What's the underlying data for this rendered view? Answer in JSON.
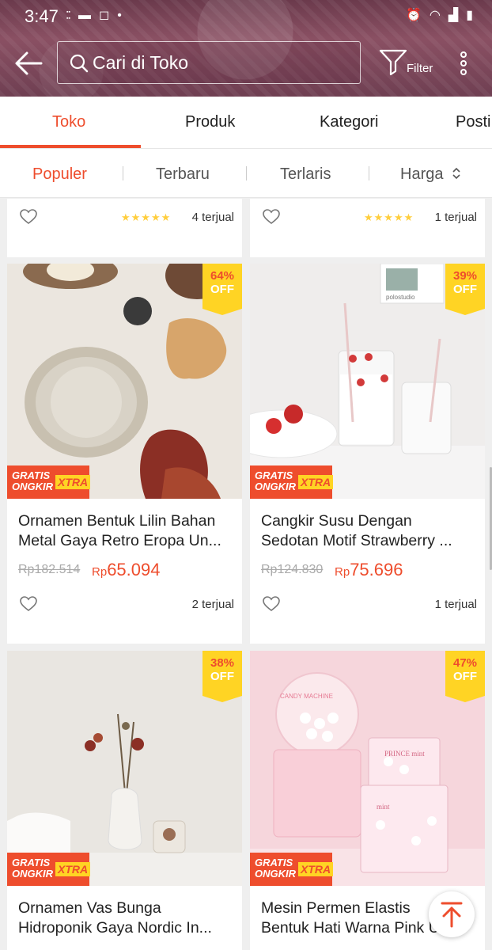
{
  "status_bar": {
    "time": "3:47"
  },
  "search": {
    "placeholder": "Cari di Toko"
  },
  "header": {
    "filter_label": "Filter"
  },
  "tabs": [
    {
      "label": "Toko",
      "active": true
    },
    {
      "label": "Produk",
      "active": false
    },
    {
      "label": "Kategori",
      "active": false
    },
    {
      "label": "Posti",
      "active": false
    }
  ],
  "sort": [
    {
      "label": "Populer",
      "active": true
    },
    {
      "label": "Terbaru",
      "active": false
    },
    {
      "label": "Terlaris",
      "active": false
    },
    {
      "label": "Harga",
      "active": false
    }
  ],
  "top_cards": [
    {
      "sold": "4 terjual",
      "rating_stars": 5
    },
    {
      "sold": "1 terjual",
      "rating_stars": 5
    }
  ],
  "products": [
    {
      "name_line1": "Ornamen Bentuk Lilin Bahan",
      "name_line2": "Metal Gaya Retro Eropa Un...",
      "old_price": "Rp182.514",
      "price_prefix": "Rp",
      "price": "65.094",
      "discount": "64%",
      "off": "OFF",
      "sold": "2 terjual",
      "badge_text": "GRATIS ONGKIR",
      "badge_extra": "XTRA"
    },
    {
      "name_line1": "Cangkir Susu Dengan",
      "name_line2": "Sedotan Motif Strawberry ...",
      "old_price": "Rp124.830",
      "price_prefix": "Rp",
      "price": "75.696",
      "discount": "39%",
      "off": "OFF",
      "sold": "1 terjual",
      "badge_text": "GRATIS ONGKIR",
      "badge_extra": "XTRA",
      "image_caption": "polostudio"
    },
    {
      "name_line1": "Ornamen Vas Bunga",
      "name_line2": "Hidroponik Gaya Nordic In...",
      "discount": "38%",
      "off": "OFF",
      "badge_text": "GRATIS ONGKIR",
      "badge_extra": "XTRA"
    },
    {
      "name_line1": "Mesin Permen Elastis",
      "name_line2": "Bentuk Hati Warna Pink Un...",
      "discount": "47%",
      "off": "OFF",
      "badge_text": "GRATIS ONGKIR",
      "badge_extra": "XTRA",
      "image_text1": "CANDY MACHINE",
      "image_text2": "PRINCE mint",
      "image_text3": "mint"
    }
  ],
  "colors": {
    "accent": "#ee4d2d",
    "badge_yellow": "#ffd424",
    "star": "#ffce3d"
  }
}
